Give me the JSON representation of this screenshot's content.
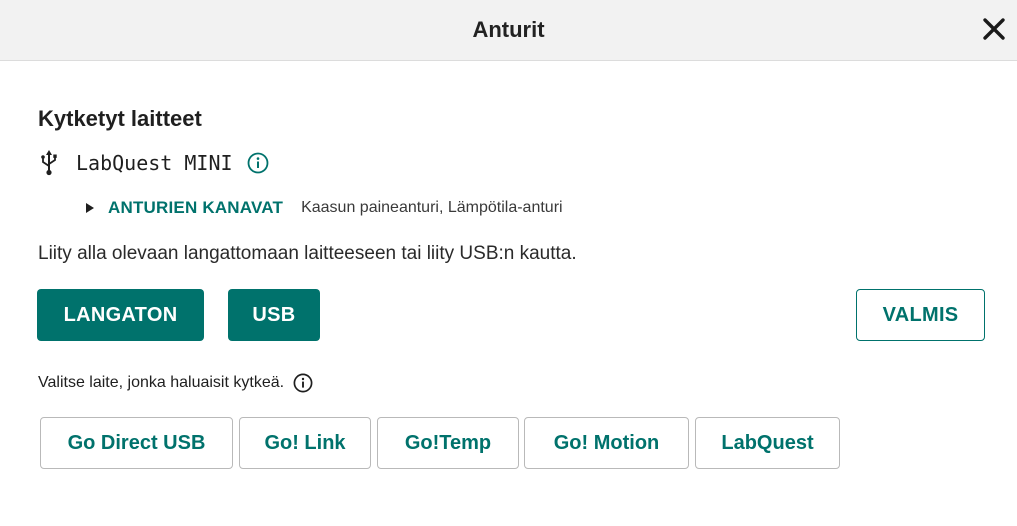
{
  "header": {
    "title": "Anturit",
    "close_icon": "close-icon"
  },
  "connected": {
    "title": "Kytketyt laitteet",
    "device_name": "LabQuest MINI",
    "device_icon": "usb-icon",
    "info_icon": "info-icon",
    "channels_label": "ANTURIEN KANAVAT",
    "channels_value": "Kaasun paineanturi, Lämpötila-anturi"
  },
  "instruction": "Liity alla olevaan langattomaan laitteeseen tai liity USB:n kautta.",
  "buttons": {
    "wireless": "LANGATON",
    "usb": "USB",
    "done": "VALMIS"
  },
  "choose": {
    "text": "Valitse laite, jonka haluaisit kytkeä."
  },
  "device_types": [
    "Go Direct USB",
    "Go! Link",
    "Go!Temp",
    "Go! Motion",
    "LabQuest"
  ],
  "colors": {
    "accent": "#00726c",
    "header_bg": "#f2f2f2"
  }
}
